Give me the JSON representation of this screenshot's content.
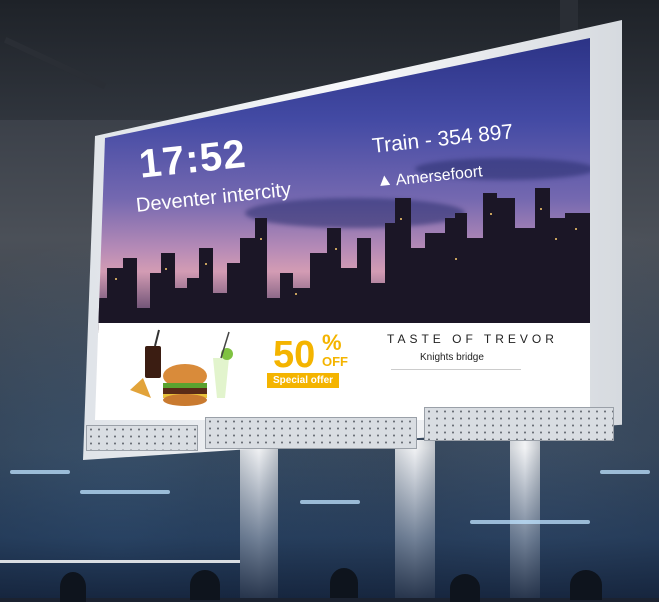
{
  "board": {
    "time": "17:52",
    "destination": "Deventer intercity",
    "train": "Train - 354 897",
    "station": "Amersefoort",
    "icons": {
      "direction": "arrow-up-icon",
      "food": "burger-combo-icon"
    }
  },
  "promo": {
    "percent_value": "50",
    "percent_sign": "%",
    "off_label": "OFF",
    "badge": "Special offer",
    "brand": "TASTE OF TREVOR",
    "brand_sub": "Knights bridge"
  },
  "colors": {
    "accent": "#f4b400",
    "sky_top": "#2c3386",
    "sky_bottom": "#d39cb4"
  }
}
